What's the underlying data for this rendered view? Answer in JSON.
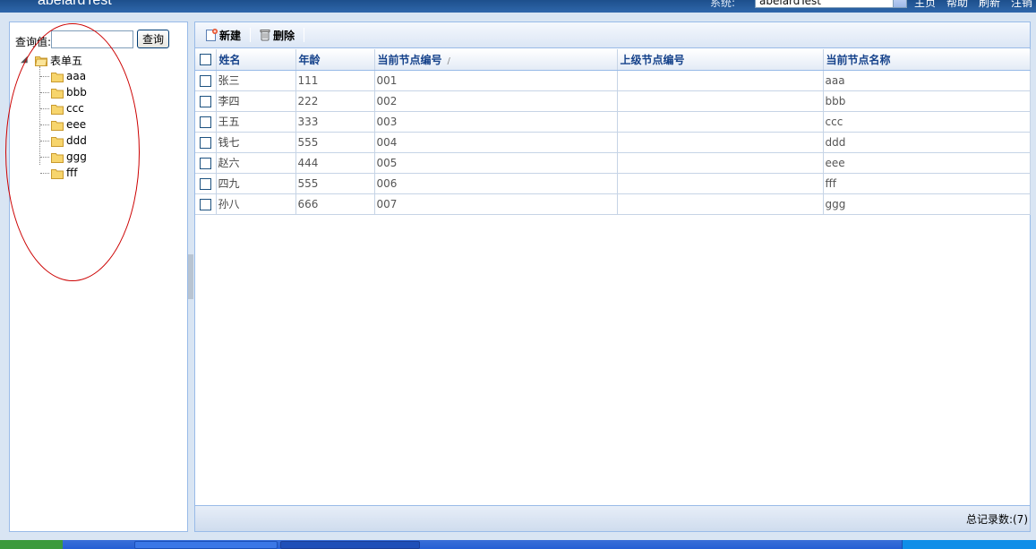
{
  "header": {
    "app_title": "abelardTest",
    "system_label": "系统:",
    "system_value": "abelardTest",
    "links": [
      "主页",
      "帮助",
      "刷新",
      "注销"
    ]
  },
  "left": {
    "search_label": "查询值:",
    "search_value": "",
    "search_button": "查询",
    "tree": {
      "root": "表单五",
      "children": [
        "aaa",
        "bbb",
        "ccc",
        "eee",
        "ddd",
        "ggg",
        "fff"
      ]
    }
  },
  "toolbar": {
    "new_label": "新建",
    "delete_label": "删除"
  },
  "grid": {
    "columns": [
      "姓名",
      "年龄",
      "当前节点编号",
      "上级节点编号",
      "当前节点名称"
    ],
    "rows": [
      [
        "张三",
        "111",
        "001",
        "",
        "aaa"
      ],
      [
        "李四",
        "222",
        "002",
        "",
        "bbb"
      ],
      [
        "王五",
        "333",
        "003",
        "",
        "ccc"
      ],
      [
        "钱七",
        "555",
        "004",
        "",
        "ddd"
      ],
      [
        "赵六",
        "444",
        "005",
        "",
        "eee"
      ],
      [
        "四九",
        "555",
        "006",
        "",
        "fff"
      ],
      [
        "孙八",
        "666",
        "007",
        "",
        "ggg"
      ]
    ]
  },
  "footer": {
    "total_label": "总记录数:(7)"
  },
  "colors": {
    "header_bg": "#2f67ab",
    "panel_border": "#99bbe8",
    "grid_header_text": "#15428b",
    "annotation_circle": "#cc0000"
  }
}
